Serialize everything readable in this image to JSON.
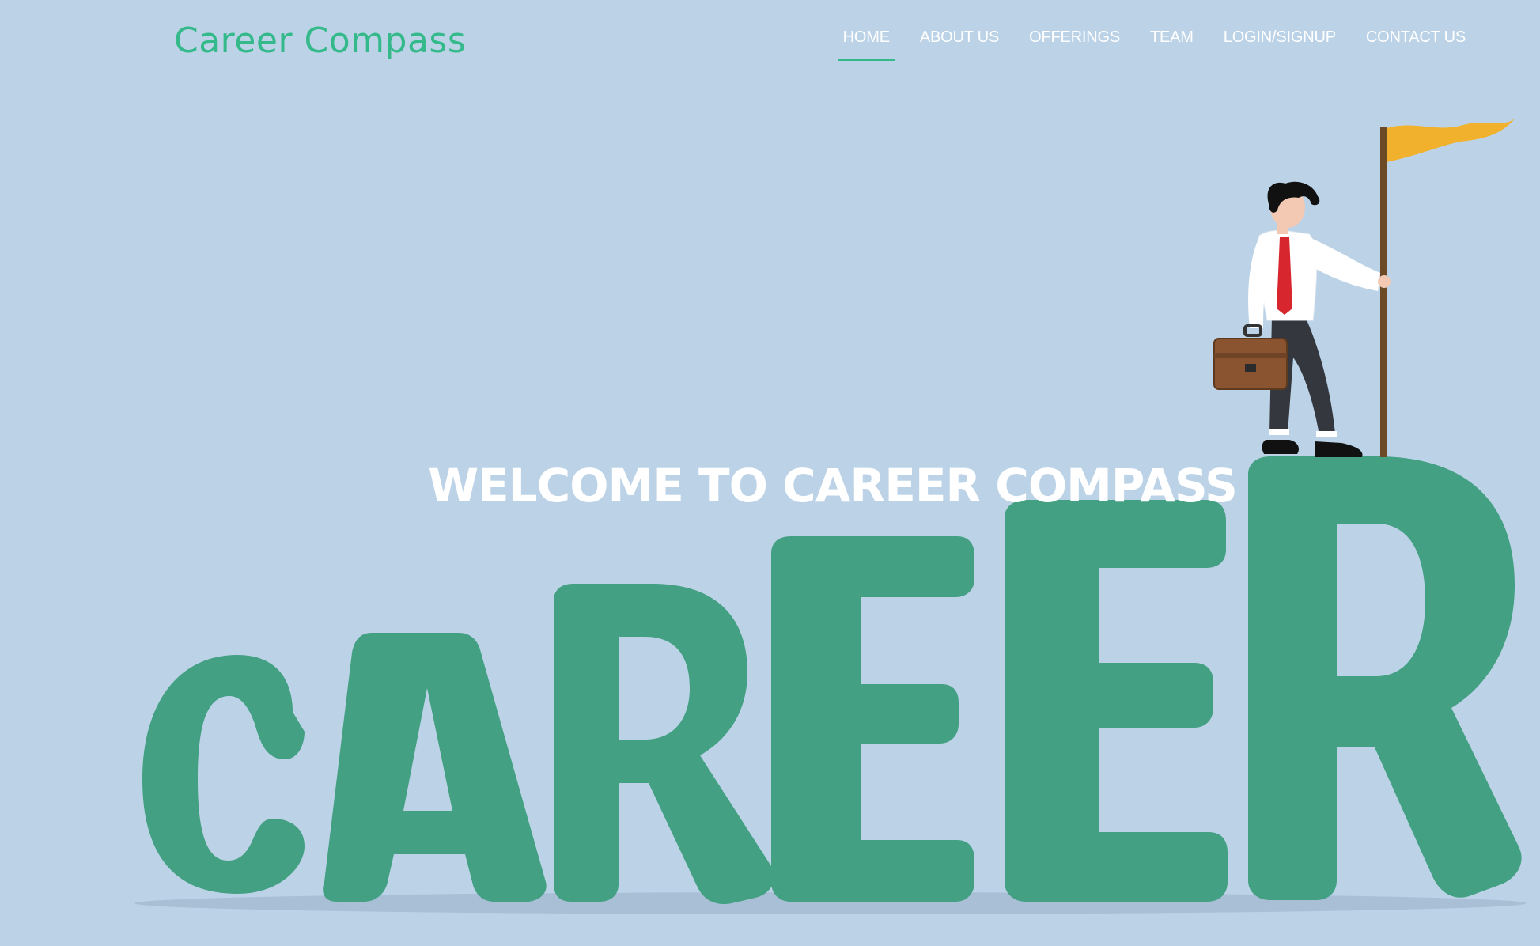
{
  "header": {
    "logo": "Career Compass",
    "nav": [
      {
        "label": "HOME",
        "active": true
      },
      {
        "label": "ABOUT US",
        "active": false
      },
      {
        "label": "OFFERINGS",
        "active": false
      },
      {
        "label": "TEAM",
        "active": false
      },
      {
        "label": "LOGIN/SIGNUP",
        "active": false
      },
      {
        "label": "CONTACT US",
        "active": false
      }
    ]
  },
  "hero": {
    "title": "WELCOME TO CAREER COMPASS",
    "illustration": "career-climber-illustration"
  },
  "colors": {
    "background": "#bcd3e7",
    "brand": "#34b98a",
    "letters": "#43a082",
    "flag": "#f2b12c"
  }
}
